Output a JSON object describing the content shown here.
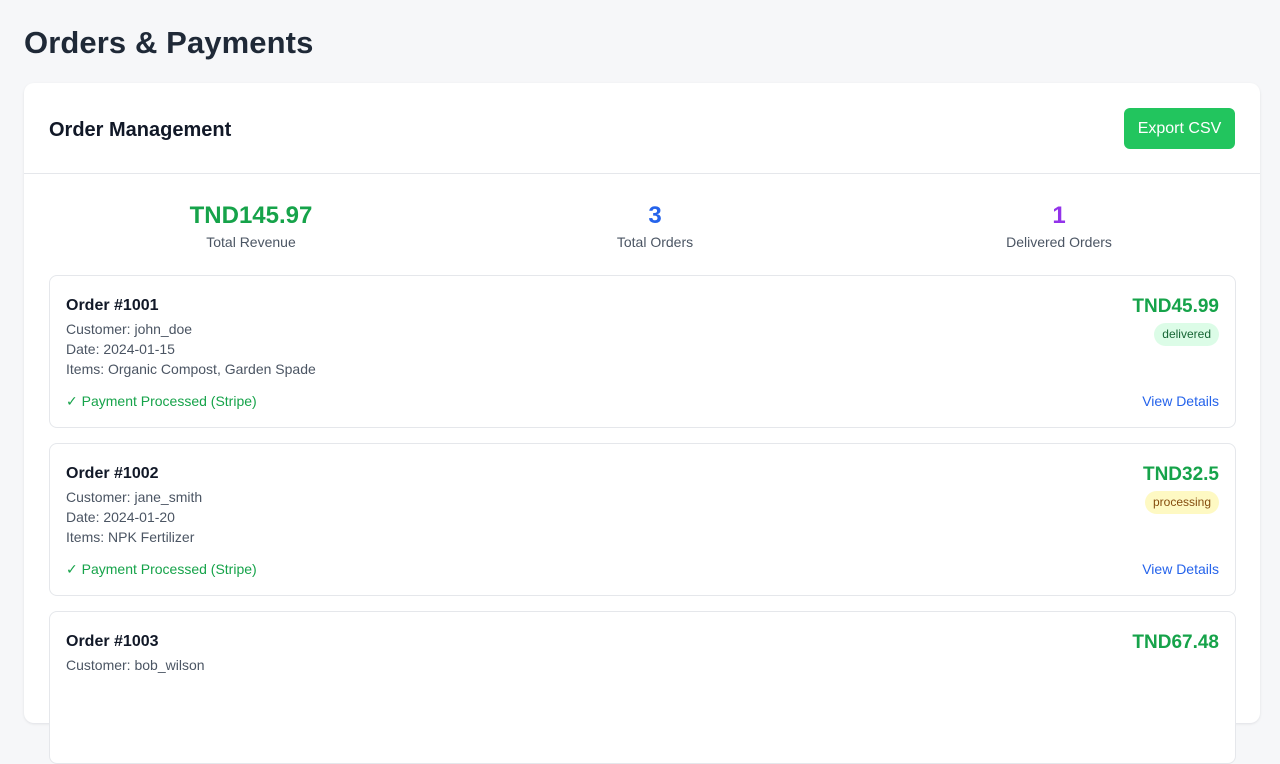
{
  "page": {
    "title": "Orders & Payments"
  },
  "card": {
    "title": "Order Management",
    "export_label": "Export CSV"
  },
  "stats": [
    {
      "value": "TND145.97",
      "label": "Total Revenue",
      "color": "#16a34a"
    },
    {
      "value": "3",
      "label": "Total Orders",
      "color": "#2563eb"
    },
    {
      "value": "1",
      "label": "Delivered Orders",
      "color": "#9333ea"
    }
  ],
  "orders": [
    {
      "id": "Order #1001",
      "customer": "Customer: john_doe",
      "date": "Date: 2024-01-15",
      "items": "Items: Organic Compost, Garden Spade",
      "amount": "TND45.99",
      "status": "delivered",
      "payment": "✓ Payment Processed (Stripe)",
      "details_label": "View Details"
    },
    {
      "id": "Order #1002",
      "customer": "Customer: jane_smith",
      "date": "Date: 2024-01-20",
      "items": "Items: NPK Fertilizer",
      "amount": "TND32.5",
      "status": "processing",
      "payment": "✓ Payment Processed (Stripe)",
      "details_label": "View Details"
    },
    {
      "id": "Order #1003",
      "customer": "Customer: bob_wilson",
      "amount": "TND67.48"
    }
  ]
}
